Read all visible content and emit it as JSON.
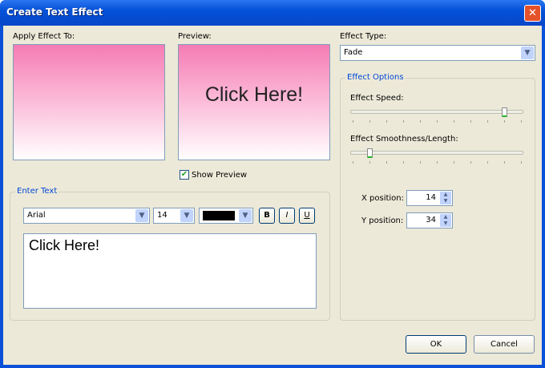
{
  "title": "Create Text Effect",
  "apply_label": "Apply Effect To:",
  "preview_label": "Preview:",
  "preview_text": "Click Here!",
  "show_preview": {
    "label": "Show Preview",
    "checked": true
  },
  "effect_type": {
    "label": "Effect Type:",
    "value": "Fade"
  },
  "effect_options": {
    "title": "Effect Options",
    "speed_label": "Effect Speed:",
    "speed_value": 9,
    "smoothness_label": "Effect Smoothness/Length:",
    "smoothness_value": 1,
    "slider_max": 10,
    "x_label": "X position:",
    "x_value": "14",
    "y_label": "Y position:",
    "y_value": "34"
  },
  "enter_text": {
    "title": "Enter Text",
    "font": "Arial",
    "size": "14",
    "color": "#000000",
    "bold": "B",
    "italic": "I",
    "underline": "U",
    "text": "Click Here!"
  },
  "ok": "OK",
  "cancel": "Cancel"
}
